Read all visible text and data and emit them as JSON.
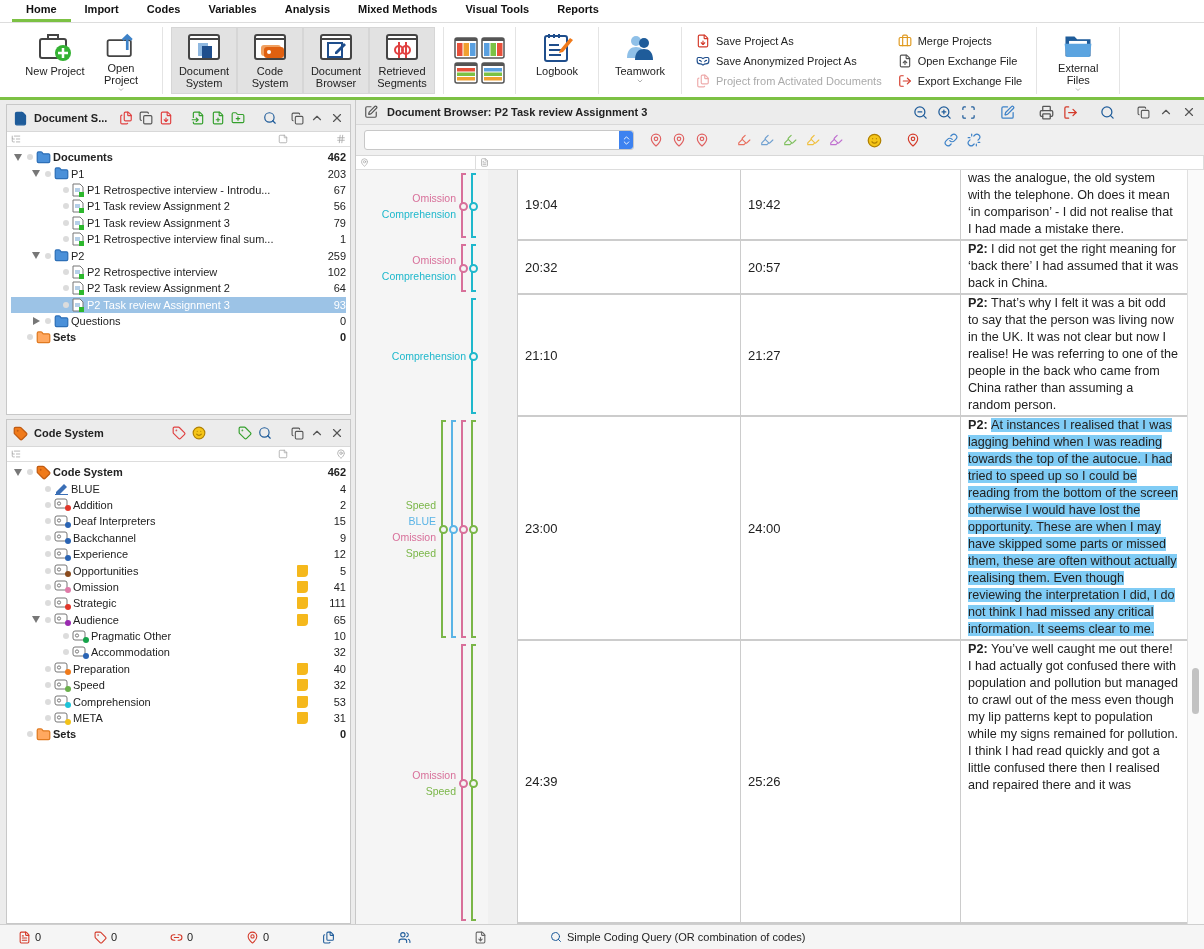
{
  "menu_tabs": [
    {
      "label": "Home",
      "selected": true
    },
    {
      "label": "Import",
      "selected": false
    },
    {
      "label": "Codes",
      "selected": false
    },
    {
      "label": "Variables",
      "selected": false
    },
    {
      "label": "Analysis",
      "selected": false
    },
    {
      "label": "Mixed Methods",
      "selected": false
    },
    {
      "label": "Visual Tools",
      "selected": false
    },
    {
      "label": "Reports",
      "selected": false
    }
  ],
  "ribbon": [
    {
      "kind": "large",
      "buttons": [
        {
          "label": "New Project",
          "selected": false,
          "dropdown": false
        },
        {
          "label": "Open Project",
          "selected": false,
          "dropdown": true
        }
      ]
    },
    {
      "kind": "large",
      "buttons": [
        {
          "label": "Document System",
          "selected": true,
          "dropdown": false
        },
        {
          "label": "Code System",
          "selected": true,
          "dropdown": false
        },
        {
          "label": "Document Browser",
          "selected": true,
          "dropdown": false
        },
        {
          "label": "Retrieved Segments",
          "selected": true,
          "dropdown": false
        }
      ]
    },
    {
      "kind": "layouts"
    },
    {
      "kind": "large",
      "buttons": [
        {
          "label": "Logbook",
          "selected": false,
          "dropdown": false
        }
      ]
    },
    {
      "kind": "large",
      "buttons": [
        {
          "label": "Teamwork",
          "selected": false,
          "dropdown": true
        }
      ]
    },
    {
      "kind": "small",
      "buttons": [
        {
          "label": "Save Project As",
          "disabled": false
        },
        {
          "label": "Save Anonymized Project As",
          "disabled": false
        },
        {
          "label": "Project from Activated Documents",
          "disabled": true
        },
        {
          "label": "Merge Projects",
          "disabled": false
        },
        {
          "label": "Open Exchange File",
          "disabled": false
        },
        {
          "label": "Export Exchange File",
          "disabled": false
        }
      ]
    },
    {
      "kind": "large",
      "buttons": [
        {
          "label": "External Files",
          "selected": false,
          "dropdown": true
        }
      ]
    }
  ],
  "document_system": {
    "title": "Document S...",
    "tree": [
      {
        "kind": "folder",
        "label": "Documents",
        "count": "462",
        "expanded": true,
        "selected": false,
        "children": [
          {
            "kind": "folder",
            "label": "P1",
            "count": "203",
            "expanded": true,
            "selected": false,
            "children": [
              {
                "kind": "document",
                "label": "P1 Retrospective interview - Introdu...",
                "count": "67",
                "selected": false
              },
              {
                "kind": "document",
                "label": "P1 Task review Assignment 2",
                "count": "56",
                "selected": false
              },
              {
                "kind": "document",
                "label": "P1 Task review Assignment 3",
                "count": "79",
                "selected": false
              },
              {
                "kind": "document",
                "label": "P1 Retrospective interview final sum...",
                "count": "1",
                "selected": false
              }
            ]
          },
          {
            "kind": "folder",
            "label": "P2",
            "count": "259",
            "expanded": true,
            "selected": false,
            "children": [
              {
                "kind": "document",
                "label": "P2 Retrospective interview",
                "count": "102",
                "selected": false
              },
              {
                "kind": "document",
                "label": "P2 Task review Assignment 2",
                "count": "64",
                "selected": false
              },
              {
                "kind": "document",
                "label": "P2 Task review Assignment 3",
                "count": "93",
                "selected": true
              }
            ]
          },
          {
            "kind": "folder",
            "label": "Questions",
            "count": "0",
            "expanded": false,
            "selected": false
          }
        ]
      },
      {
        "kind": "set",
        "label": "Sets",
        "count": "0",
        "selected": false
      }
    ]
  },
  "code_system": {
    "title": "Code System",
    "tree": [
      {
        "kind": "root",
        "label": "Code System",
        "count": "462",
        "expanded": true,
        "children": [
          {
            "kind": "highlight",
            "label": "BLUE",
            "count": "4",
            "color": "#3b6fb6",
            "memo": false
          },
          {
            "kind": "code",
            "label": "Addition",
            "count": "2",
            "color": "#e2372b",
            "memo": false
          },
          {
            "kind": "code",
            "label": "Deaf Interpreters",
            "count": "15",
            "color": "#2a64b4",
            "memo": false
          },
          {
            "kind": "code",
            "label": "Backchannel",
            "count": "9",
            "color": "#2a64b4",
            "memo": false
          },
          {
            "kind": "code",
            "label": "Experience",
            "count": "12",
            "color": "#2a64b4",
            "memo": false
          },
          {
            "kind": "code",
            "label": "Opportunities",
            "count": "5",
            "color": "#8a4a1c",
            "memo": true
          },
          {
            "kind": "code",
            "label": "Omission",
            "count": "41",
            "color": "#e07aa8",
            "memo": true
          },
          {
            "kind": "code",
            "label": "Strategic",
            "count": "111",
            "color": "#e2372b",
            "memo": true
          },
          {
            "kind": "code",
            "label": "Audience",
            "count": "65",
            "color": "#9a2ab0",
            "memo": true,
            "expanded": true,
            "children": [
              {
                "kind": "code",
                "label": "Pragmatic Other",
                "count": "10",
                "color": "#16a34a",
                "memo": false
              },
              {
                "kind": "code",
                "label": "Accommodation",
                "count": "32",
                "color": "#2a64b4",
                "memo": false
              }
            ]
          },
          {
            "kind": "code",
            "label": "Preparation",
            "count": "40",
            "color": "#f07a1a",
            "memo": true
          },
          {
            "kind": "code",
            "label": "Speed",
            "count": "32",
            "color": "#6ab04a",
            "memo": true
          },
          {
            "kind": "code",
            "label": "Comprehension",
            "count": "53",
            "color": "#1cc4d8",
            "memo": true
          },
          {
            "kind": "code",
            "label": "META",
            "count": "31",
            "color": "#f2c218",
            "memo": true
          }
        ]
      },
      {
        "kind": "set",
        "label": "Sets",
        "count": "0"
      }
    ]
  },
  "document_browser": {
    "title": "Document Browser: P2 Task review Assignment 3",
    "rows": [
      {
        "start": "19:04",
        "end": "19:42",
        "text": "was the analogue, the old system with the telephone. Oh does it mean ‘in comparison’ - I did not realise that I had made a mistake there.",
        "highlighted": false,
        "codings": [
          {
            "label": "Omission",
            "color": "#d8709a"
          },
          {
            "label": "Comprehension",
            "color": "#1fb8cc"
          }
        ]
      },
      {
        "start": "20:32",
        "end": "20:57",
        "speaker": "P2:",
        "text": "I did not get the right meaning for ‘back there’ I had assumed that it was back in China.",
        "highlighted": false,
        "codings": [
          {
            "label": "Omission",
            "color": "#d8709a"
          },
          {
            "label": "Comprehension",
            "color": "#1fb8cc"
          }
        ]
      },
      {
        "start": "21:10",
        "end": "21:27",
        "speaker": "P2:",
        "text": "That’s why I felt it was a bit odd to say that the person was living now in the UK. It was not clear but now I realise! He was referring to one of the people in the back who came from China rather than assuming a random person.",
        "highlighted": false,
        "codings": [
          {
            "label": "Comprehension",
            "color": "#1fb8cc"
          }
        ]
      },
      {
        "start": "23:00",
        "end": "24:00",
        "speaker": "P2:",
        "text": "At instances I realised that I was lagging behind when I was reading towards the top of the autocue. I had tried to speed up so I could be reading from the bottom of the screen otherwise I would have lost the opportunity. These are when I may have skipped some parts or missed them, these are often without actually realising them. Even though reviewing the interpretation I did, I do not think I had missed any critical information. It seems clear to me.",
        "highlighted": true,
        "codings": [
          {
            "label": "Speed",
            "color": "#7ab648"
          },
          {
            "label": "BLUE",
            "color": "#5ab4e6"
          },
          {
            "label": "Omission",
            "color": "#d8709a"
          },
          {
            "label": "Speed",
            "color": "#7ab648"
          }
        ]
      },
      {
        "start": "24:39",
        "end": "25:26",
        "speaker": "P2:",
        "text": "You’ve well caught me out there! I had actually got confused there with population and pollution but managed to crawl out of the mess even though my lip patterns kept to population while my signs remained for pollution. I think I had read quickly and got a little confused there then I realised and repaired there and it was",
        "highlighted": false,
        "codings": [
          {
            "label": "Omission",
            "color": "#d8709a"
          },
          {
            "label": "Speed",
            "color": "#7ab648"
          }
        ]
      }
    ]
  },
  "status_bar": {
    "counters": [
      "0",
      "0",
      "0",
      "0"
    ],
    "query": "Simple Coding Query (OR combination of codes)"
  }
}
